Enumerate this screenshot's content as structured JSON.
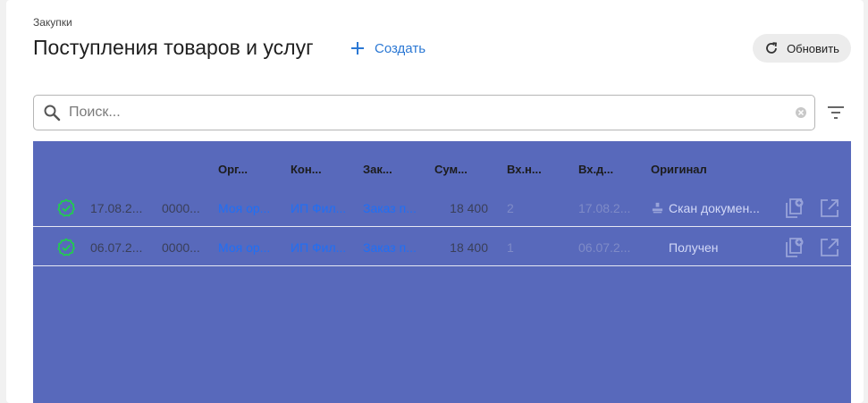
{
  "header": {
    "breadcrumb": "Закупки",
    "title": "Поступления товаров и услуг",
    "create_label": "Создать",
    "refresh_label": "Обновить"
  },
  "search": {
    "placeholder": "Поиск...",
    "value": ""
  },
  "table": {
    "columns": [
      "Орг...",
      "Кон...",
      "Зак...",
      "Сум...",
      "Вх.н...",
      "Вх.д...",
      "Оригинал"
    ],
    "rows": [
      {
        "status": "posted",
        "date": "17.08.2...",
        "number": "0000...",
        "organization": "Моя ор...",
        "counterparty": "ИП Фил...",
        "order": "Заказ п...",
        "sum": "18 400",
        "in_number": "2",
        "in_date": "17.08.2...",
        "original": "Скан докумен...",
        "original_icon": "stamp-icon"
      },
      {
        "status": "posted",
        "date": "06.07.2...",
        "number": "0000...",
        "organization": "Моя ор...",
        "counterparty": "ИП Фил...",
        "order": "Заказ п...",
        "sum": "18 400",
        "in_number": "1",
        "in_date": "06.07.2...",
        "original": "Получен",
        "original_icon": ""
      }
    ]
  },
  "colors": {
    "accent": "#2b78d4",
    "table_bg": "#5869bb",
    "status_ok": "#1fd14a",
    "link": "#1f6ff5"
  },
  "icons": {
    "create": "plus-icon",
    "refresh": "refresh-icon",
    "search": "search-icon",
    "clear": "clear-icon",
    "filter": "filter-icon",
    "row_actions": [
      "copy-add-icon",
      "open-external-icon"
    ]
  }
}
